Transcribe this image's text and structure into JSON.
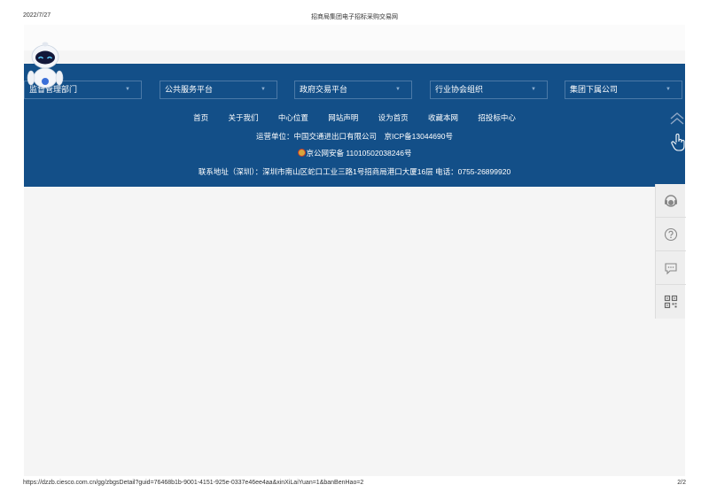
{
  "print_header": {
    "date": "2022/7/27",
    "title": "招商局集团电子招标采购交易网"
  },
  "print_footer": {
    "url": "https://dzzb.ciesco.com.cn/gg/zbgsDetail?guid=76468b1b-9001-4151-925e-0337e46ee4aa&xinXiLaiYuan=1&banBenHao=2",
    "page": "2/2"
  },
  "footer": {
    "selects": [
      {
        "label": "监督管理部门"
      },
      {
        "label": "公共服务平台"
      },
      {
        "label": "政府交易平台"
      },
      {
        "label": "行业协会组织"
      },
      {
        "label": "集团下属公司"
      }
    ],
    "nav": [
      "首页",
      "关于我们",
      "中心位置",
      "网站声明",
      "设为首页",
      "收藏本网",
      "招投标中心"
    ],
    "operator": "运营单位：中国交通进出口有限公司　京ICP备13044690号",
    "police_record": "京公网安备 11010502038246号",
    "address": "联系地址（深圳）：深圳市南山区蛇口工业三路1号招商局港口大厦16层  电话：0755-26899920"
  },
  "colors": {
    "footer_bg": "#134f88",
    "page_bg": "#f5f5f5",
    "side_panel_bg": "#eeeeee"
  },
  "icons": [
    "robot-mascot-icon",
    "scroll-top-icon",
    "hand-pointer-icon",
    "customer-service-icon",
    "help-icon",
    "message-icon",
    "qrcode-icon"
  ]
}
